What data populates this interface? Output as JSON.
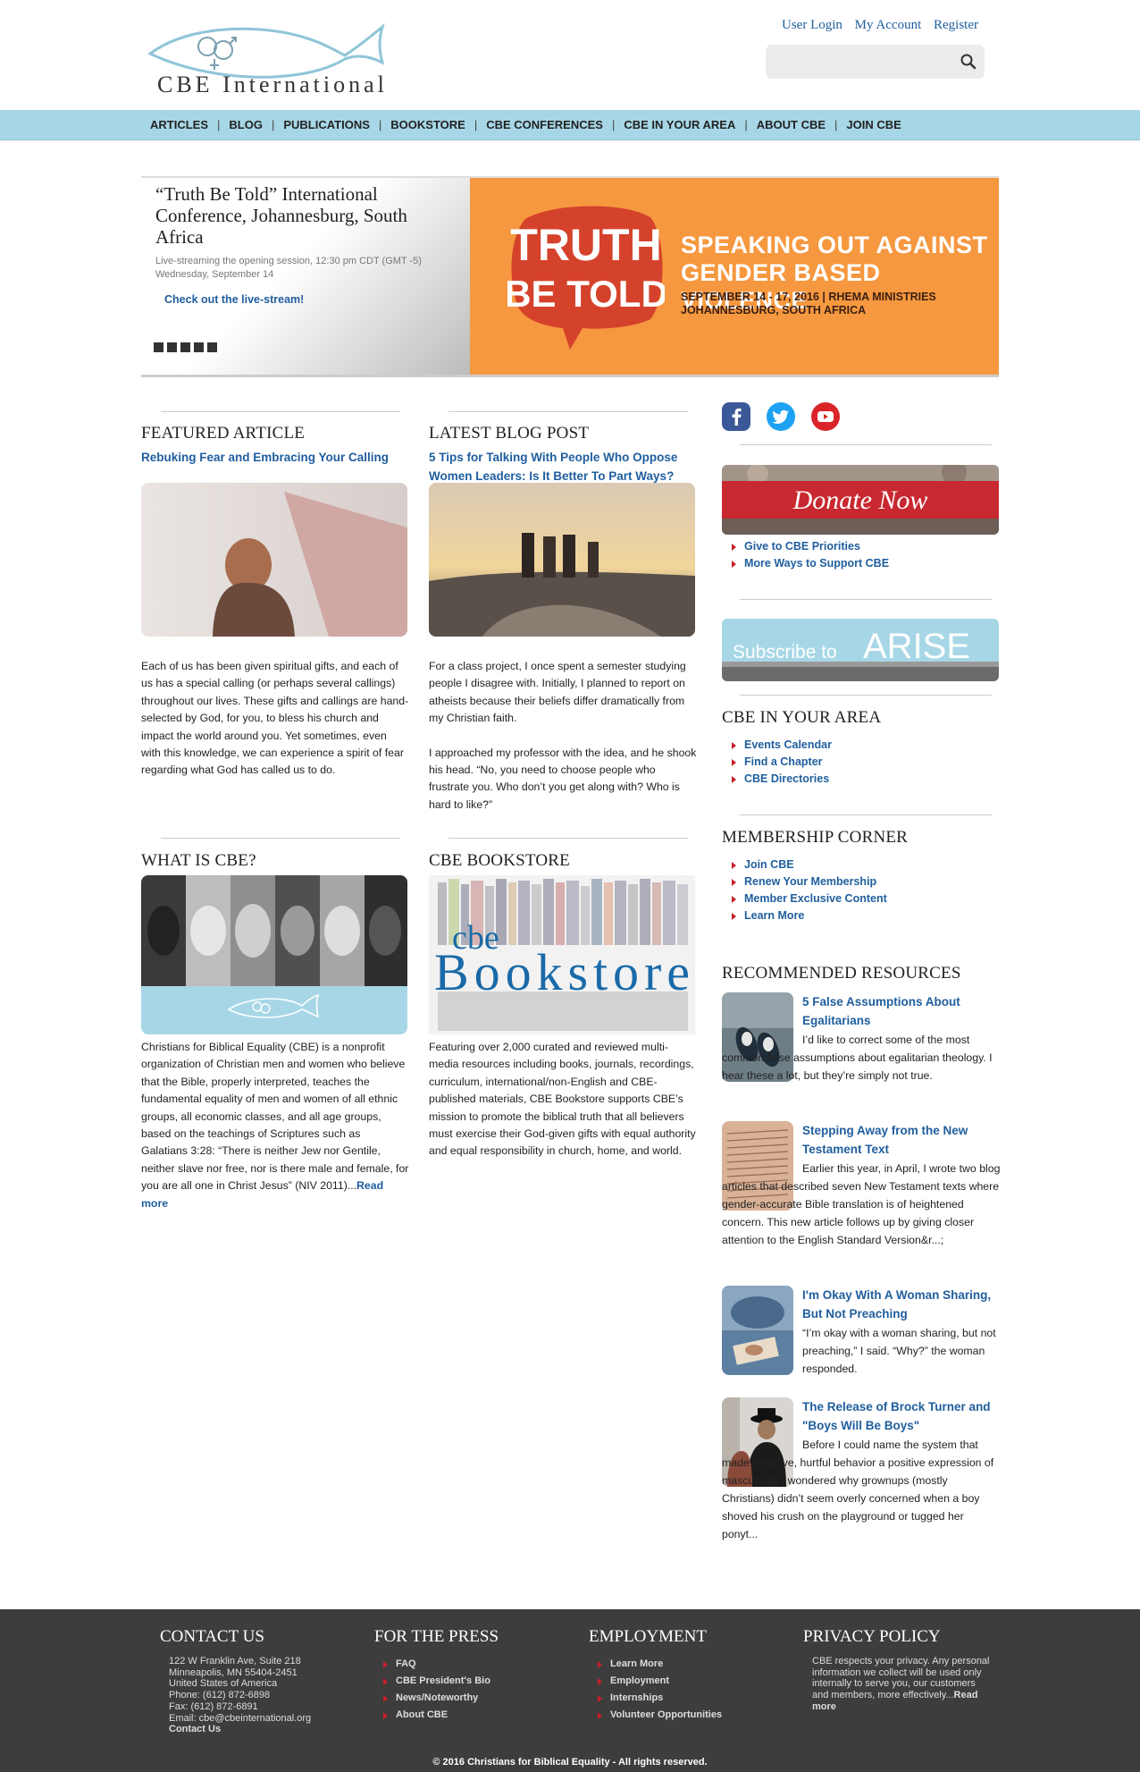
{
  "header": {
    "logo_text": "CBE International",
    "user_links": [
      "User Login",
      "My Account",
      "Register"
    ],
    "search_placeholder": ""
  },
  "nav": [
    "ARTICLES",
    "BLOG",
    "PUBLICATIONS",
    "BOOKSTORE",
    "CBE CONFERENCES",
    "CBE IN YOUR AREA",
    "ABOUT CBE",
    "JOIN CBE"
  ],
  "hero": {
    "title": "“Truth Be Told” International Conference, Johannesburg, South Africa",
    "sub1": "Live-streaming the opening session, 12:30 pm CDT (GMT -5)",
    "sub2": "Wednesday, September 14",
    "link": "Check out the live-stream!",
    "banner_logo_line1": "TRUTH",
    "banner_logo_line2": "BE TOLD",
    "banner_head1": "SPEAKING OUT AGAINST",
    "banner_head2": "GENDER BASED VIOLENCE",
    "banner_sub1": "SEPTEMBER 14 - 17, 2016 | RHEMA MINISTRIES",
    "banner_sub2": "JOHANNESBURG, SOUTH AFRICA"
  },
  "featured": {
    "heading": "FEATURED ARTICLE",
    "title": "Rebuking Fear and Embracing Your Calling",
    "body": "Each of us has been given spiritual gifts, and each of us has a special calling (or perhaps several callings) throughout our lives. These gifts and callings are hand-selected by God, for you, to bless his church and impact the world around you. Yet sometimes, even with this knowledge, we can experience a spirit of fear regarding what God has called us to do."
  },
  "blog": {
    "heading": "LATEST BLOG POST",
    "title": "5 Tips for Talking With People Who Oppose Women Leaders: Is It Better To Part Ways?",
    "body1": "For a class project, I once spent a semester studying people I disagree with. Initially, I planned to report on atheists because their beliefs differ dramatically from my Christian faith.",
    "body2": "I approached my professor with the idea, and he shook his head. “No, you need to choose people who frustrate you. Who don’t you get along with? Who is hard to like?”"
  },
  "whatis": {
    "heading": "WHAT IS CBE?",
    "body": "Christians for Biblical Equality (CBE) is a nonprofit organization of Christian men and women who believe that the Bible, properly interpreted, teaches the fundamental equality of men and women of all ethnic groups, all economic classes, and all age groups, based on the teachings of Scriptures such as Galatians 3:28: “There is neither Jew nor Gentile, neither slave nor free, nor is there male and female, for you are all one in Christ Jesus” (NIV 2011)...",
    "read_more": "Read more"
  },
  "bookstore": {
    "heading": "CBE BOOKSTORE",
    "logo_small": "cbe",
    "logo_big": "Bookstore",
    "body": "Featuring over 2,000 curated and reviewed multi-media resources including books, journals, recordings, curriculum, international/non-English and CBE-published materials, CBE Bookstore supports CBE’s mission to promote the biblical truth that all believers must exercise their God-given gifts with equal authority and equal responsibility in church, home, and world."
  },
  "sidebar": {
    "donate_label": "Donate Now",
    "donate_links": [
      "Give to CBE Priorities",
      "More Ways to Support CBE"
    ],
    "subscribe_a": "Subscribe to",
    "subscribe_b": "ARISE",
    "area_heading": "CBE IN YOUR AREA",
    "area_links": [
      "Events Calendar",
      "Find a Chapter",
      "CBE Directories"
    ],
    "member_heading": "MEMBERSHIP CORNER",
    "member_links": [
      "Join CBE",
      "Renew Your Membership",
      "Member Exclusive Content",
      "Learn More"
    ],
    "rec_heading": "RECOMMENDED RESOURCES",
    "resources": [
      {
        "title": "5 False Assumptions About Egalitarians",
        "text": "I’d like to correct some of the most common false assumptions about egalitarian theology. I hear these a lot, but they’re simply not true."
      },
      {
        "title": "Stepping Away from the New Testament Text",
        "text": "Earlier this year, in April, I wrote two blog articles that described seven New Testament texts where gender-accurate Bible translation is of heightened concern. This new article follows up by giving closer attention to the English Standard Version&r...;"
      },
      {
        "title": "I'm Okay With A Woman Sharing, But Not Preaching",
        "text": "“I’m okay with a woman sharing, but not preaching,” I said. “Why?” the woman responded."
      },
      {
        "title": "The Release of Brock Turner and \"Boys Will Be Boys\"",
        "text": "Before I could name the system that made negative, hurtful behavior a positive expression of masculinity, I wondered why grownups (mostly Christians) didn’t seem overly concerned when a boy shoved his crush on the playground or tugged her ponyt..."
      }
    ]
  },
  "footer": {
    "contact_heading": "CONTACT US",
    "contact_lines": [
      "122 W Franklin Ave, Suite 218",
      "Minneapolis, MN  55404-2451",
      "United States of America",
      "Phone: (612) 872-6898",
      "Fax: (612) 872-6891",
      "Email: cbe@cbeinternational.org",
      "Contact Us"
    ],
    "press_heading": "FOR THE PRESS",
    "press_links": [
      "FAQ",
      "CBE President's Bio",
      "News/Noteworthy",
      "About CBE"
    ],
    "employment_heading": "EMPLOYMENT",
    "employment_links": [
      "Learn More",
      "Employment",
      "Internships",
      "Volunteer Opportunities"
    ],
    "privacy_heading": "PRIVACY POLICY",
    "privacy_text": "CBE respects your privacy. Any personal information we collect will be used only internally to serve you, our customers and members, more effectively...",
    "privacy_read_more": "Read more",
    "copyright": "© 2016 Christians for Biblical Equality - All rights reserved."
  },
  "colors": {
    "nav_bg": "#a7d7e6",
    "link": "#1f5e9e",
    "banner": "#f6983f",
    "footer_bg": "#3d3d3d",
    "bullet": "#c8202a"
  }
}
